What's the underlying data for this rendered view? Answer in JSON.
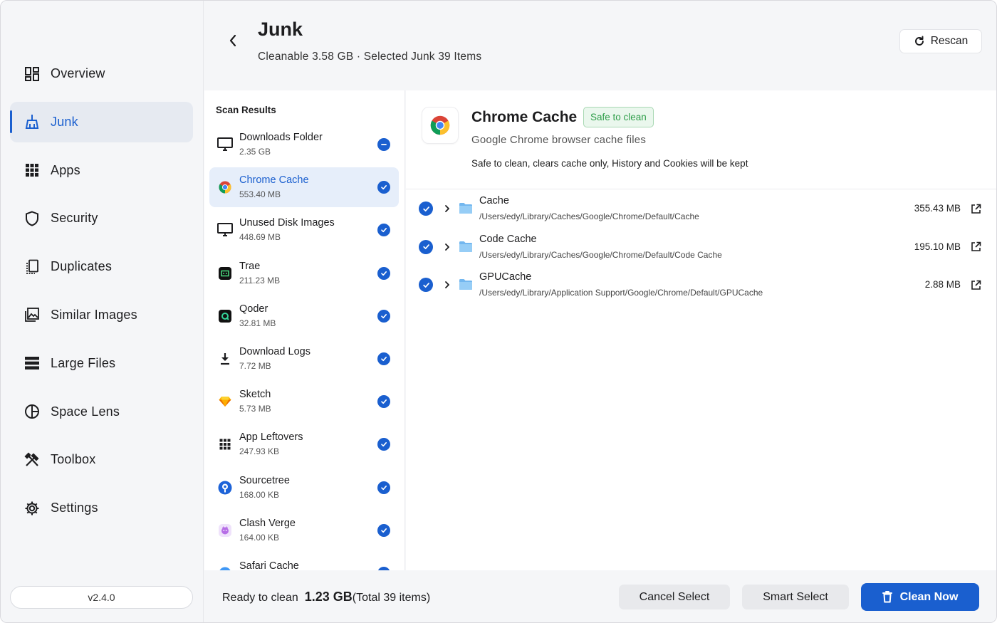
{
  "sidebar": {
    "items": [
      {
        "label": "Overview",
        "icon": "overview-icon",
        "active": false
      },
      {
        "label": "Junk",
        "icon": "broom-icon",
        "active": true
      },
      {
        "label": "Apps",
        "icon": "apps-grid-icon",
        "active": false
      },
      {
        "label": "Security",
        "icon": "shield-icon",
        "active": false
      },
      {
        "label": "Duplicates",
        "icon": "duplicates-icon",
        "active": false
      },
      {
        "label": "Similar Images",
        "icon": "image-icon",
        "active": false
      },
      {
        "label": "Large Files",
        "icon": "large-files-icon",
        "active": false
      },
      {
        "label": "Space Lens",
        "icon": "pie-chart-icon",
        "active": false
      },
      {
        "label": "Toolbox",
        "icon": "toolbox-icon",
        "active": false
      },
      {
        "label": "Settings",
        "icon": "gear-icon",
        "active": false
      }
    ],
    "version": "v2.4.0"
  },
  "header": {
    "title": "Junk",
    "subtitle": "Cleanable 3.58 GB · Selected Junk 39 Items",
    "rescan_label": "Rescan"
  },
  "results": {
    "title": "Scan Results",
    "items": [
      {
        "name": "Downloads Folder",
        "size": "2.35 GB",
        "icon": "monitor-icon",
        "check": "partial",
        "selected": false
      },
      {
        "name": "Chrome Cache",
        "size": "553.40 MB",
        "icon": "chrome-icon",
        "check": "checked",
        "selected": true
      },
      {
        "name": "Unused Disk Images",
        "size": "448.69 MB",
        "icon": "monitor-icon",
        "check": "checked",
        "selected": false
      },
      {
        "name": "Trae",
        "size": "211.23 MB",
        "icon": "trae-icon",
        "check": "checked",
        "selected": false
      },
      {
        "name": "Qoder",
        "size": "32.81 MB",
        "icon": "qoder-icon",
        "check": "checked",
        "selected": false
      },
      {
        "name": "Download Logs",
        "size": "7.72 MB",
        "icon": "download-icon",
        "check": "checked",
        "selected": false
      },
      {
        "name": "Sketch",
        "size": "5.73 MB",
        "icon": "sketch-icon",
        "check": "checked",
        "selected": false
      },
      {
        "name": "App Leftovers",
        "size": "247.93 KB",
        "icon": "apps-grid-icon",
        "check": "checked",
        "selected": false
      },
      {
        "name": "Sourcetree",
        "size": "168.00 KB",
        "icon": "sourcetree-icon",
        "check": "checked",
        "selected": false
      },
      {
        "name": "Clash Verge",
        "size": "164.00 KB",
        "icon": "clash-verge-icon",
        "check": "checked",
        "selected": false
      },
      {
        "name": "Safari Cache",
        "size": "",
        "icon": "safari-icon",
        "check": "checked",
        "selected": false
      }
    ]
  },
  "detail": {
    "title": "Chrome Cache",
    "badge": "Safe to clean",
    "description": "Google Chrome browser cache files",
    "note": "Safe to clean, clears cache only, History and Cookies will be kept",
    "files": [
      {
        "name": "Cache",
        "path": "/Users/edy/Library/Caches/Google/Chrome/Default/Cache",
        "size": "355.43 MB"
      },
      {
        "name": "Code Cache",
        "path": "/Users/edy/Library/Caches/Google/Chrome/Default/Code Cache",
        "size": "195.10 MB"
      },
      {
        "name": "GPUCache",
        "path": "/Users/edy/Library/Application Support/Google/Chrome/Default/GPUCache",
        "size": "2.88 MB"
      }
    ]
  },
  "footer": {
    "ready_label": "Ready to clean",
    "amount": "1.23 GB",
    "total": "(Total 39 items)",
    "cancel_label": "Cancel Select",
    "smart_label": "Smart Select",
    "clean_label": "Clean Now"
  },
  "colors": {
    "accent": "#1a5fcf",
    "safe_green": "#2f9e4a",
    "sidebar_bg": "#f5f6f8"
  }
}
